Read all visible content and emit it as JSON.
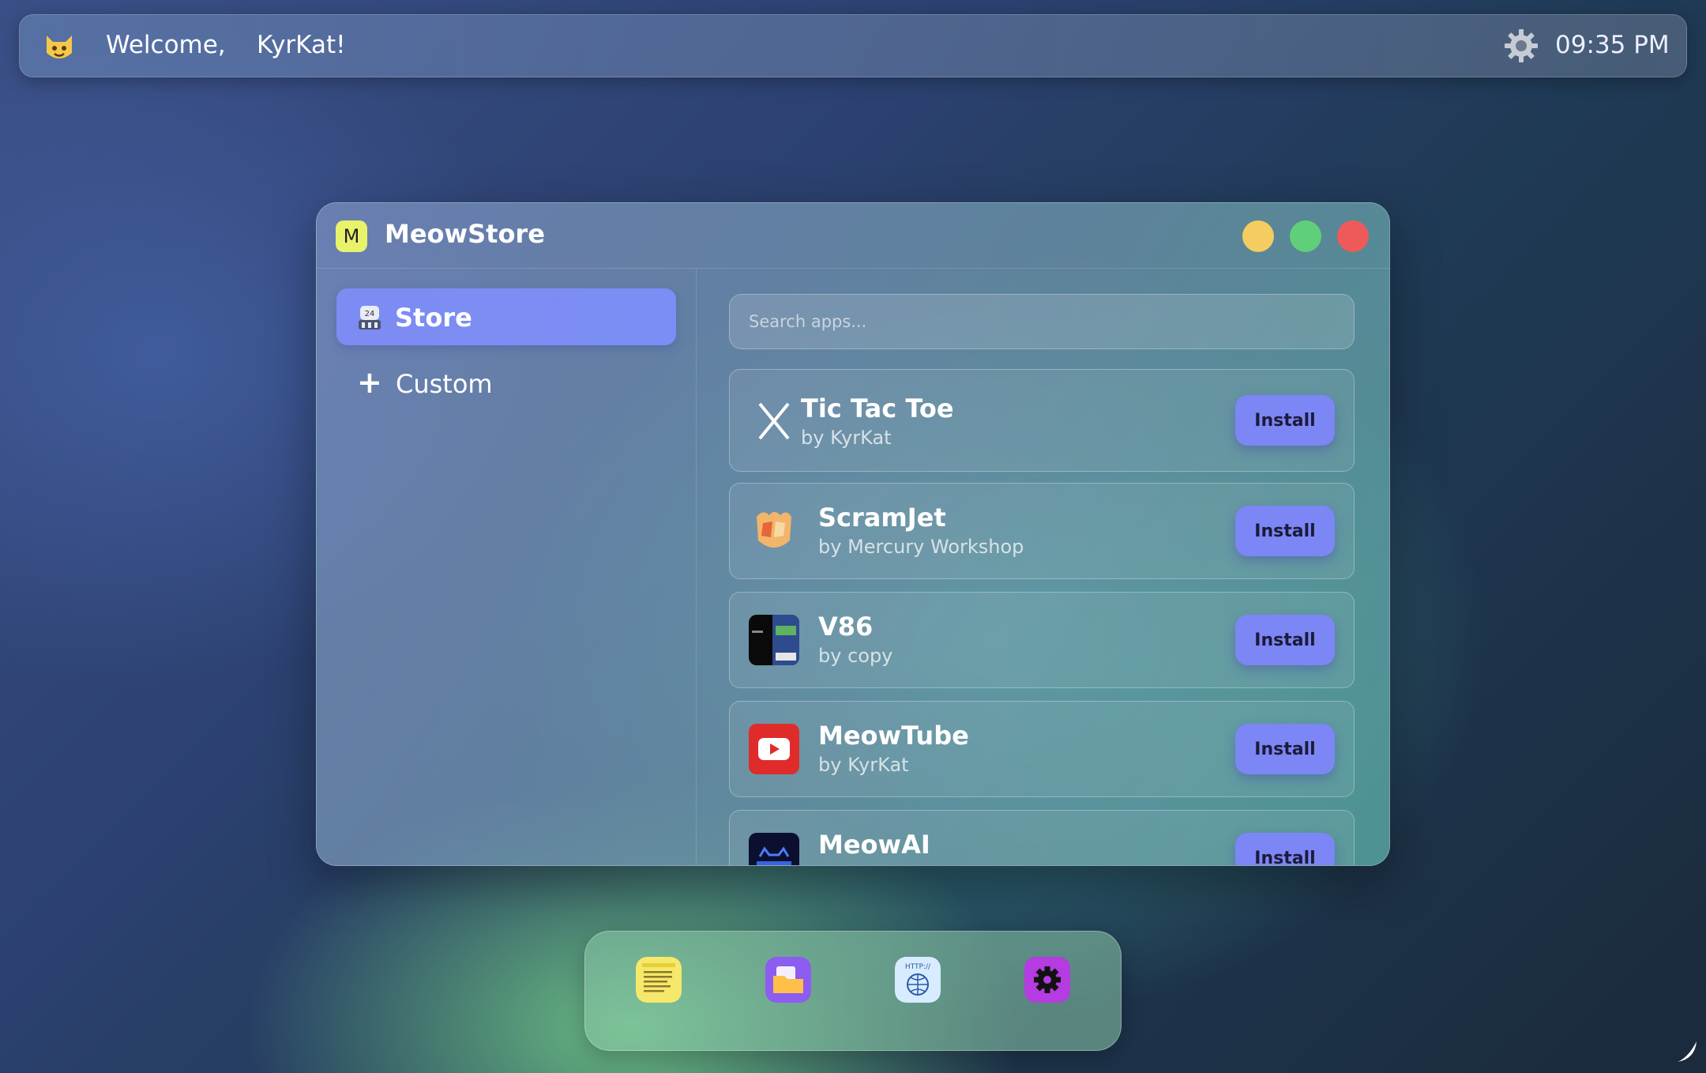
{
  "topbar": {
    "welcome": "Welcome,",
    "username": "KyrKat!",
    "time": "09:35 PM",
    "icons": [
      "cat-face-icon",
      "settings-gear-icon"
    ]
  },
  "window": {
    "title": "MeowStore",
    "logo_letter": "M",
    "traffic_lights": {
      "minimize": "#f4cc60",
      "maximize": "#5fcf7a",
      "close": "#ee5a5a"
    }
  },
  "sidebar": {
    "items": [
      {
        "label": "Store",
        "active": true,
        "icon": "store-robot-icon"
      },
      {
        "label": "Custom",
        "active": false,
        "icon": "plus-icon"
      }
    ]
  },
  "search": {
    "placeholder": "Search apps...",
    "value": ""
  },
  "apps": [
    {
      "name": "Tic Tac Toe",
      "author": "by KyrKat",
      "button": "Install",
      "icon": "x-letter-icon"
    },
    {
      "name": "ScramJet",
      "author": "by Mercury Workshop",
      "button": "Install",
      "icon": "scramjet-icon"
    },
    {
      "name": "V86",
      "author": "by copy",
      "button": "Install",
      "icon": "v86-terminal-icon"
    },
    {
      "name": "MeowTube",
      "author": "by KyrKat",
      "button": "Install",
      "icon": "youtube-play-icon"
    },
    {
      "name": "MeowAI",
      "author": "",
      "button": "Install",
      "icon": "meowai-icon"
    }
  ],
  "dock": {
    "items": [
      "notes-icon",
      "files-icon",
      "browser-icon",
      "settings-icon"
    ]
  },
  "colors": {
    "accent": "#7c86f4",
    "sidebar_active": "#7b8ef5"
  }
}
